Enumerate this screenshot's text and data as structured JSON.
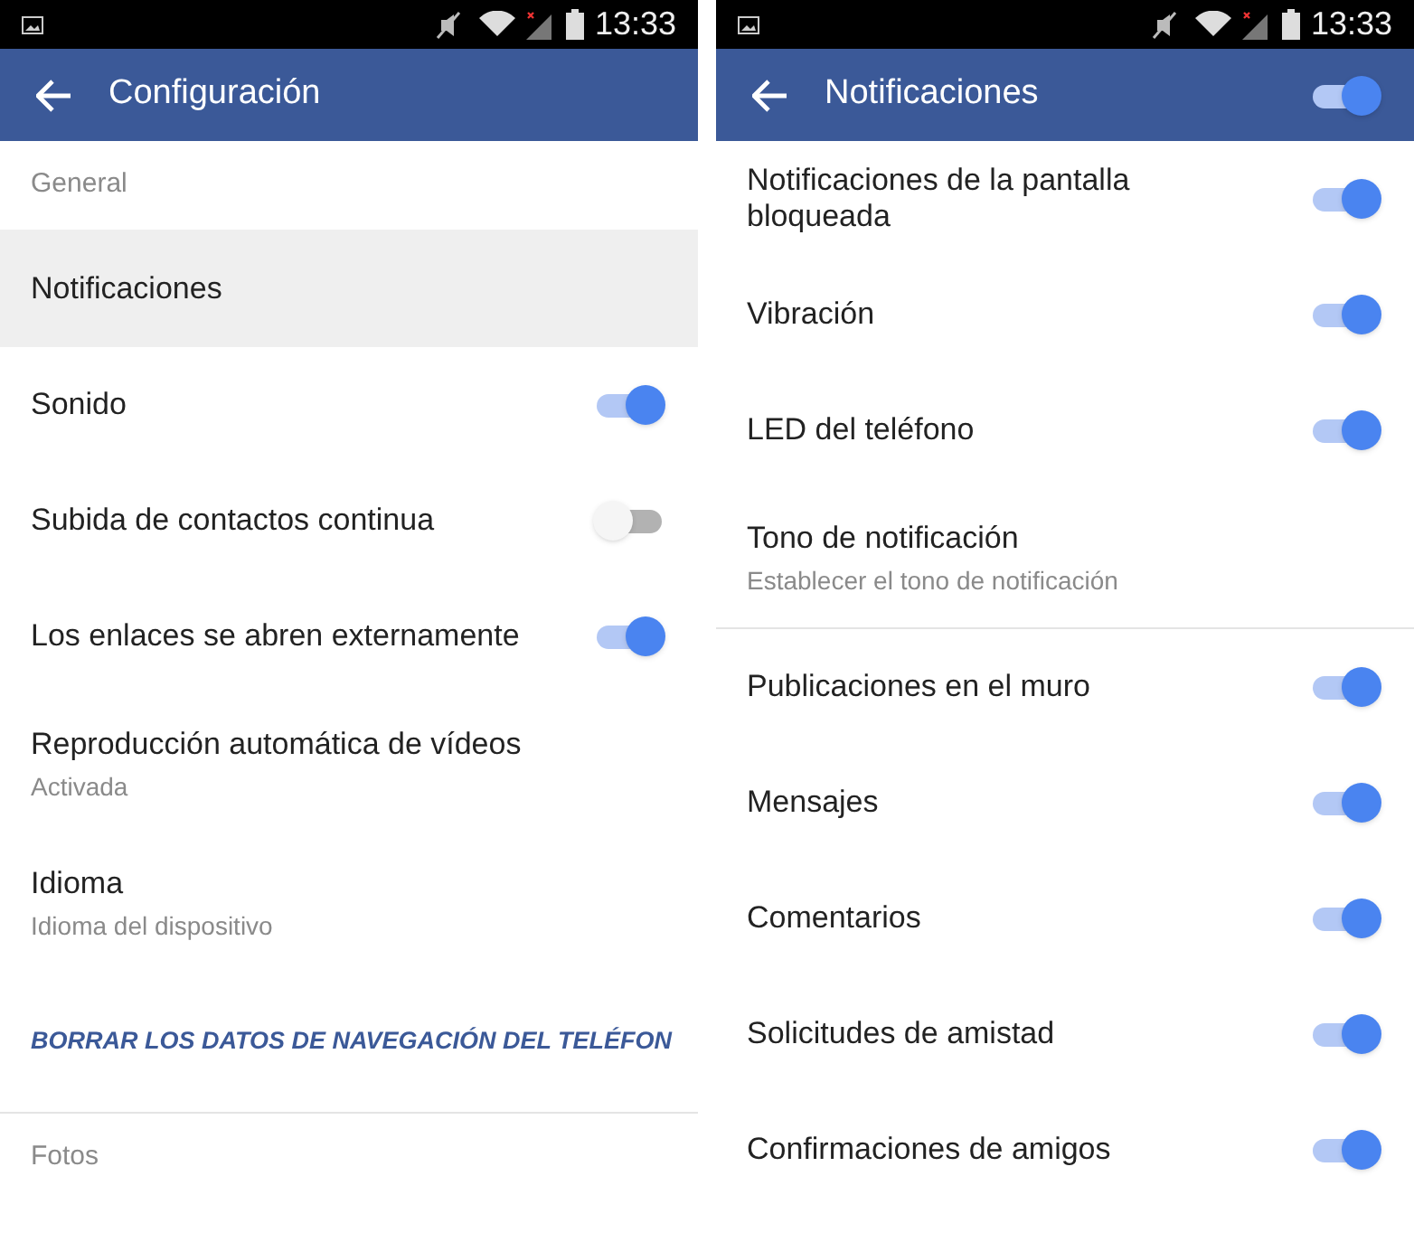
{
  "screens": [
    {
      "status_bar": {
        "time": "13:33"
      },
      "app_bar": {
        "title": "Configuración"
      },
      "items": [
        {
          "kind": "header",
          "label": "General"
        },
        {
          "kind": "item",
          "label": "Notificaciones",
          "selected": true
        },
        {
          "kind": "toggle",
          "label": "Sonido",
          "on": true
        },
        {
          "kind": "toggle",
          "label": "Subida de contactos continua",
          "on": false
        },
        {
          "kind": "toggle",
          "label": "Los enlaces se abren externamente",
          "on": true
        },
        {
          "kind": "item",
          "label": "Reproducción automática de vídeos",
          "subtitle": "Activada",
          "selected": false
        },
        {
          "kind": "item",
          "label": "Idioma",
          "subtitle": "Idioma del dispositivo",
          "selected": false
        },
        {
          "kind": "link",
          "label": "BORRAR LOS DATOS DE NAVEGACIÓN DEL TELÉFON"
        },
        {
          "kind": "divider"
        },
        {
          "kind": "header",
          "label": "Fotos"
        }
      ]
    },
    {
      "status_bar": {
        "time": "13:33"
      },
      "app_bar": {
        "title": "Notificaciones",
        "on": true
      },
      "items": [
        {
          "kind": "toggle",
          "label": "Notificaciones de la pantalla bloqueada",
          "on": true
        },
        {
          "kind": "toggle",
          "label": "Vibración",
          "on": true
        },
        {
          "kind": "toggle",
          "label": "LED del teléfono",
          "on": true
        },
        {
          "kind": "item",
          "label": "Tono de notificación",
          "subtitle": "Establecer el tono de notificación",
          "selected": false
        },
        {
          "kind": "divider"
        },
        {
          "kind": "toggle",
          "label": "Publicaciones en el muro",
          "on": true
        },
        {
          "kind": "toggle",
          "label": "Mensajes",
          "on": true
        },
        {
          "kind": "toggle",
          "label": "Comentarios",
          "on": true
        },
        {
          "kind": "toggle",
          "label": "Solicitudes de amistad",
          "on": true
        },
        {
          "kind": "toggle",
          "label": "Confirmaciones de amigos",
          "on": true
        }
      ]
    }
  ]
}
